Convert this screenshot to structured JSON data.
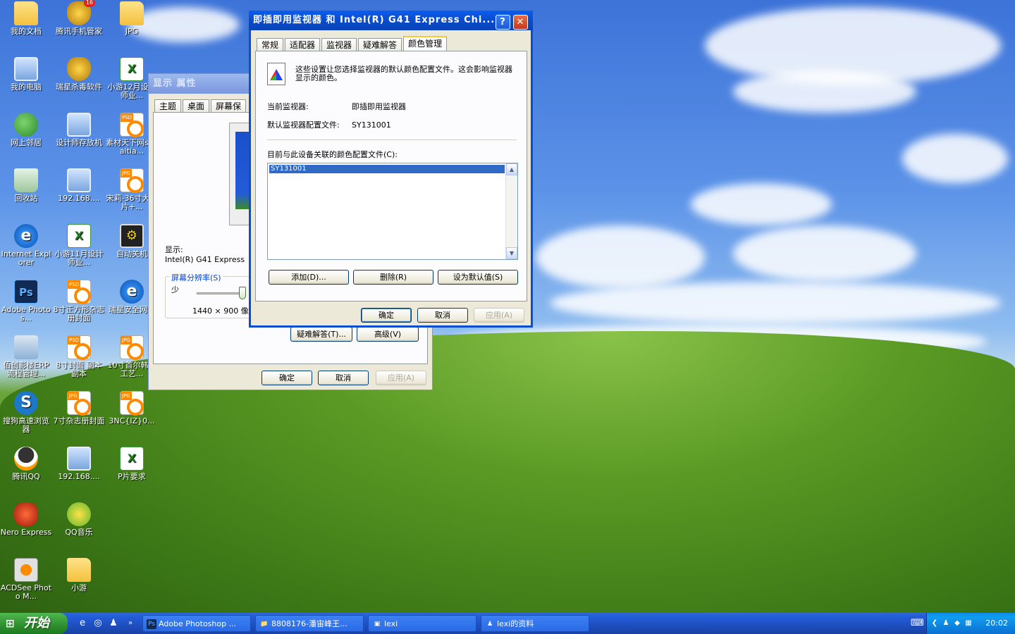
{
  "desktop_icons": [
    {
      "label": "我的文档",
      "icon": "folder",
      "badge": ""
    },
    {
      "label": "腾讯手机管家",
      "icon": "shield",
      "badge": "16"
    },
    {
      "label": "JPG",
      "icon": "folder",
      "badge": ""
    },
    {
      "label": "我的电脑",
      "icon": "computer",
      "badge": ""
    },
    {
      "label": "瑞星杀毒软件",
      "icon": "shield",
      "badge": ""
    },
    {
      "label": "小游12月设计师业...",
      "icon": "excel",
      "badge": ""
    },
    {
      "label": "网上邻居",
      "icon": "net",
      "badge": ""
    },
    {
      "label": "设计师存放机",
      "icon": "computer",
      "badge": ""
    },
    {
      "label": "素材天下网sucaitia...",
      "icon": "psd",
      "badge": ""
    },
    {
      "label": "回收站",
      "icon": "bin",
      "badge": ""
    },
    {
      "label": "192.168....",
      "icon": "computer",
      "badge": ""
    },
    {
      "label": "宋莉-36寸大单片+...",
      "icon": "jpg",
      "badge": ""
    },
    {
      "label": "Internet Explorer",
      "icon": "ie",
      "badge": ""
    },
    {
      "label": "小游11月设计师业...",
      "icon": "excel",
      "badge": ""
    },
    {
      "label": "自动关机",
      "icon": "shutdown",
      "badge": ""
    },
    {
      "label": "Adobe Photos...",
      "icon": "ps",
      "badge": ""
    },
    {
      "label": "8寸正方形杂志册封面",
      "icon": "psd",
      "badge": ""
    },
    {
      "label": "瑞星安全网址",
      "icon": "ie",
      "badge": ""
    },
    {
      "label": "佰创影楼ERP流程管理...",
      "icon": "erp",
      "badge": ""
    },
    {
      "label": "8寸封面 副本副本",
      "icon": "psd",
      "badge": ""
    },
    {
      "label": "10寸首尔韩式工艺...",
      "icon": "jpg",
      "badge": ""
    },
    {
      "label": "搜狗高速浏览器",
      "icon": "sogou",
      "badge": ""
    },
    {
      "label": "7寸杂志册封面",
      "icon": "jpg",
      "badge": ""
    },
    {
      "label": "3NC{IZ}0...",
      "icon": "jpg",
      "badge": ""
    },
    {
      "label": "腾讯QQ",
      "icon": "qq",
      "badge": ""
    },
    {
      "label": "192.168....",
      "icon": "computer",
      "badge": ""
    },
    {
      "label": "P片要求",
      "icon": "excel",
      "badge": ""
    },
    {
      "label": "Nero Express",
      "icon": "nero",
      "badge": ""
    },
    {
      "label": "QQ音乐",
      "icon": "music",
      "badge": ""
    },
    {
      "label": "",
      "icon": "",
      "badge": ""
    },
    {
      "label": "ACDSee Photo M...",
      "icon": "acdsee",
      "badge": ""
    },
    {
      "label": "小游",
      "icon": "folder",
      "badge": ""
    }
  ],
  "display_props": {
    "title": "显示 属性",
    "tabs": [
      "主题",
      "桌面",
      "屏幕保"
    ],
    "display_label": "显示:",
    "display_value": "Intel(R) G41 Express",
    "resolution_group": "屏幕分辨率(S)",
    "less_label": "少",
    "resolution_value": "1440 × 900 像素",
    "troubleshoot_btn": "疑难解答(T)...",
    "advanced_btn": "高级(V)",
    "ok": "确定",
    "cancel": "取消",
    "apply": "应用(A)"
  },
  "monitor_dialog": {
    "title": "即插即用监视器 和 Intel(R) G41 Express Chi...",
    "help": "?",
    "close": "✕",
    "tabs": [
      "常规",
      "适配器",
      "监视器",
      "疑难解答",
      "颜色管理"
    ],
    "description": "这些设置让您选择监视器的默认颜色配置文件。这会影响监视器显示的颜色。",
    "current_monitor_label": "当前监视器:",
    "current_monitor_value": "即插即用监视器",
    "default_profile_label": "默认监视器配置文件:",
    "default_profile_value": "SY131001",
    "associated_label": "目前与此设备关联的颜色配置文件(C):",
    "profiles": [
      "SY131001"
    ],
    "add_btn": "添加(D)...",
    "remove_btn": "删除(R)",
    "set_default_btn": "设为默认值(S)",
    "ok": "确定",
    "cancel": "取消",
    "apply": "应用(A)"
  },
  "taskbar": {
    "start_label": "开始",
    "tasks": [
      {
        "label": "Adobe Photoshop ...",
        "icon": "Ps"
      },
      {
        "label": "8808176-潘宙峰王...",
        "icon": "📁"
      },
      {
        "label": "lexi",
        "icon": "▣"
      },
      {
        "label": "lexi的资料",
        "icon": "♟"
      }
    ],
    "clock": "20:02"
  }
}
